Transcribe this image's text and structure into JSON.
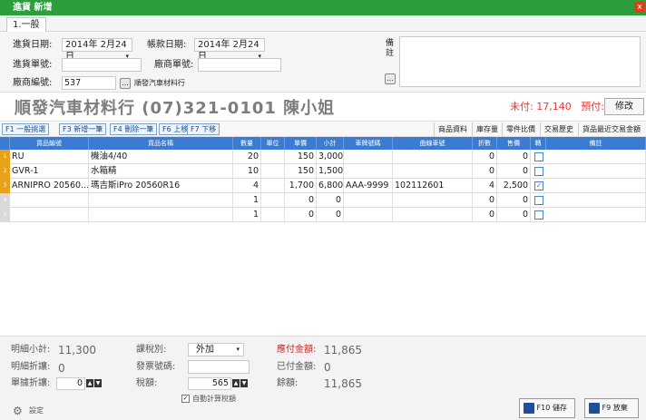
{
  "window": {
    "title": "進貨 新增",
    "close": "x"
  },
  "tabs": [
    {
      "label": "1.一般"
    }
  ],
  "header": {
    "purchase_date_label": "進貨日期:",
    "purchase_date_value": "2014年 2月24日",
    "purchase_no_label": "進貨單號:",
    "purchase_no_value": "",
    "vendor_code_label": "廠商編號:",
    "vendor_code_value": "537",
    "vendor_code_btn": "...",
    "vendor_name": "順發汽車材料行",
    "account_date_label": "帳款日期:",
    "account_date_value": "2014年 2月24日",
    "vendor_no_label": "廠商單號:",
    "vendor_no_value": "",
    "remark_label_1": "備",
    "remark_label_2": "註",
    "remark_btn": "...",
    "remark_value": ""
  },
  "supplier": {
    "headline": "順發汽車材料行 (07)321-0101 陳小姐",
    "unpaid": "未付: 17,140",
    "prepaid": "預付: 0",
    "edit_label": "修改"
  },
  "toolbar": {
    "left": [
      "F1 一般挑選",
      "F3 新增一筆",
      "F4 刪除一筆",
      "F6 上移",
      "F7 下移"
    ],
    "right": [
      "商品資料",
      "庫存量",
      "零件比價",
      "交易歷史",
      "貨品最近交易金額"
    ]
  },
  "grid": {
    "columns": [
      "貨品編號",
      "貨品名稱",
      "數量",
      "單位",
      "單價",
      "小計",
      "車牌號碼",
      "曲線車號",
      "折數",
      "售價",
      "轉",
      "備註"
    ],
    "rows": [
      {
        "no": "1",
        "code": "RU",
        "name": "機油4/40",
        "qty": "20",
        "unit": "",
        "price": "150",
        "subtotal": "3,000",
        "plate": "",
        "curve": "",
        "discount": "0",
        "sale": "0",
        "checked": false,
        "note": ""
      },
      {
        "no": "2",
        "code": "GVR-1",
        "name": "水箱精",
        "qty": "10",
        "unit": "",
        "price": "150",
        "subtotal": "1,500",
        "plate": "",
        "curve": "",
        "discount": "0",
        "sale": "0",
        "checked": false,
        "note": ""
      },
      {
        "no": "3",
        "code": "ARNIPRO 20560...",
        "name": "瑪吉斯iPro 20560R16",
        "qty": "4",
        "unit": "",
        "price": "1,700",
        "subtotal": "6,800",
        "plate": "AAA-9999",
        "curve": "102112601",
        "discount": "4",
        "sale": "2,500",
        "checked": true,
        "note": ""
      },
      {
        "no": "4",
        "code": "",
        "name": "",
        "qty": "1",
        "unit": "",
        "price": "0",
        "subtotal": "0",
        "plate": "",
        "curve": "",
        "discount": "0",
        "sale": "0",
        "checked": false,
        "note": ""
      },
      {
        "no": "5",
        "code": "",
        "name": "",
        "qty": "1",
        "unit": "",
        "price": "0",
        "subtotal": "0",
        "plate": "",
        "curve": "",
        "discount": "0",
        "sale": "0",
        "checked": false,
        "note": ""
      }
    ]
  },
  "footer": {
    "detail_subtotal_label": "明細小計:",
    "detail_subtotal_value": "11,300",
    "detail_discount_label": "明細折讓:",
    "detail_discount_value": "0",
    "doc_discount_label": "單據折讓:",
    "doc_discount_value": "0",
    "tax_type_label": "課稅別:",
    "tax_type_value": "外加",
    "invoice_label": "發票號碼:",
    "invoice_value": "",
    "tax_label": "稅額:",
    "tax_value": "565",
    "auto_tax_label": "自動計算稅額",
    "payable_label": "應付金額:",
    "payable_value": "11,865",
    "paid_label": "已付金額:",
    "paid_value": "0",
    "balance_label": "餘額:",
    "balance_value": "11,865",
    "settings_label": "設定",
    "save_label": "F10 儲存",
    "discard_label": "F9 放棄"
  },
  "colors": {
    "titlebar": "#2d9e3c",
    "grid_header": "#3b7bd4",
    "row_number": "#e8a21a",
    "unpaid": "#e53935"
  }
}
